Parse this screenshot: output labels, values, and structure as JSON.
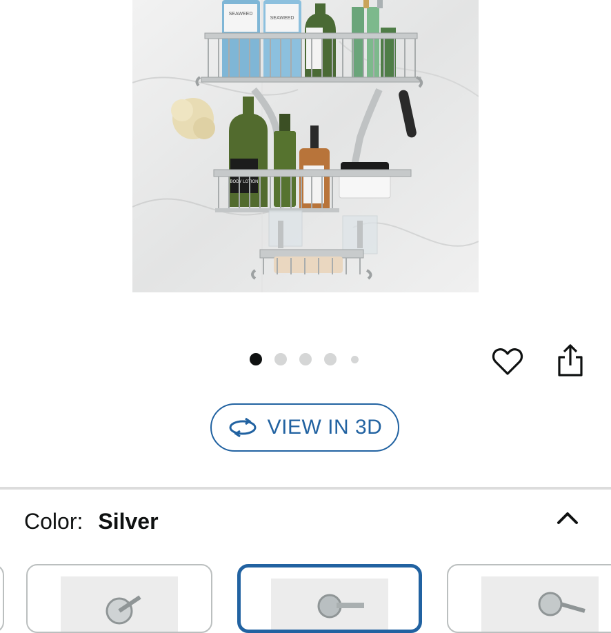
{
  "gallery": {
    "image_alt": "Silver shower caddy with three shelves",
    "bottle_labels": [
      "SEAWEED",
      "SEAWEED",
      "BODY LOTION"
    ],
    "dots": {
      "count": 5,
      "active_index": 0
    }
  },
  "actions": {
    "wishlist_icon": "heart-icon",
    "share_icon": "share-icon"
  },
  "view3d": {
    "label": "VIEW IN 3D",
    "icon": "rotate-3d-icon",
    "accent": "#2162a1"
  },
  "variant": {
    "label": "Color:",
    "value": "Silver",
    "toggle_icon": "chevron-up-icon"
  },
  "swatches": [
    {
      "name": "swatch-option-1",
      "selected": false
    },
    {
      "name": "swatch-option-2",
      "selected": true
    },
    {
      "name": "swatch-option-3",
      "selected": false
    }
  ]
}
